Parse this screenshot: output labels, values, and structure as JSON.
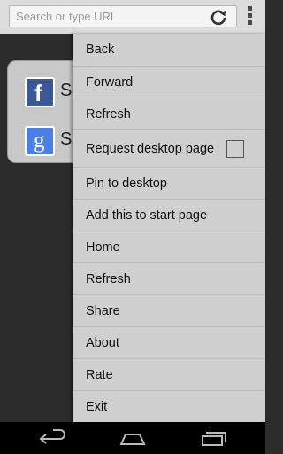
{
  "topbar": {
    "url_placeholder": "Search or type URL",
    "reload_icon": "reload-icon",
    "overflow_icon": "overflow-menu-icon"
  },
  "speed_dial": {
    "items": [
      {
        "icon": "facebook-icon",
        "letter": "f",
        "label": "Se"
      },
      {
        "icon": "google-icon",
        "letter": "g",
        "label": "Se"
      }
    ]
  },
  "menu": {
    "items": [
      {
        "label": "Back"
      },
      {
        "label": "Forward"
      },
      {
        "label": "Refresh"
      },
      {
        "label": "Request desktop page",
        "checkbox": false
      },
      {
        "label": "Pin to desktop"
      },
      {
        "label": "Add this to start page"
      },
      {
        "label": "Home"
      },
      {
        "label": "Refresh"
      },
      {
        "label": "Share"
      },
      {
        "label": "About"
      },
      {
        "label": "Rate"
      },
      {
        "label": "Exit"
      }
    ]
  },
  "navbar": {
    "back_icon": "back-icon",
    "home_icon": "home-icon",
    "recents_icon": "recent-apps-icon"
  },
  "colors": {
    "menu_bg": "#cfcfcf",
    "topbar_bg": "#dcdcdc",
    "page_bg": "#2c2c2c",
    "facebook": "#3b5998",
    "google": "#4a7fe8"
  }
}
